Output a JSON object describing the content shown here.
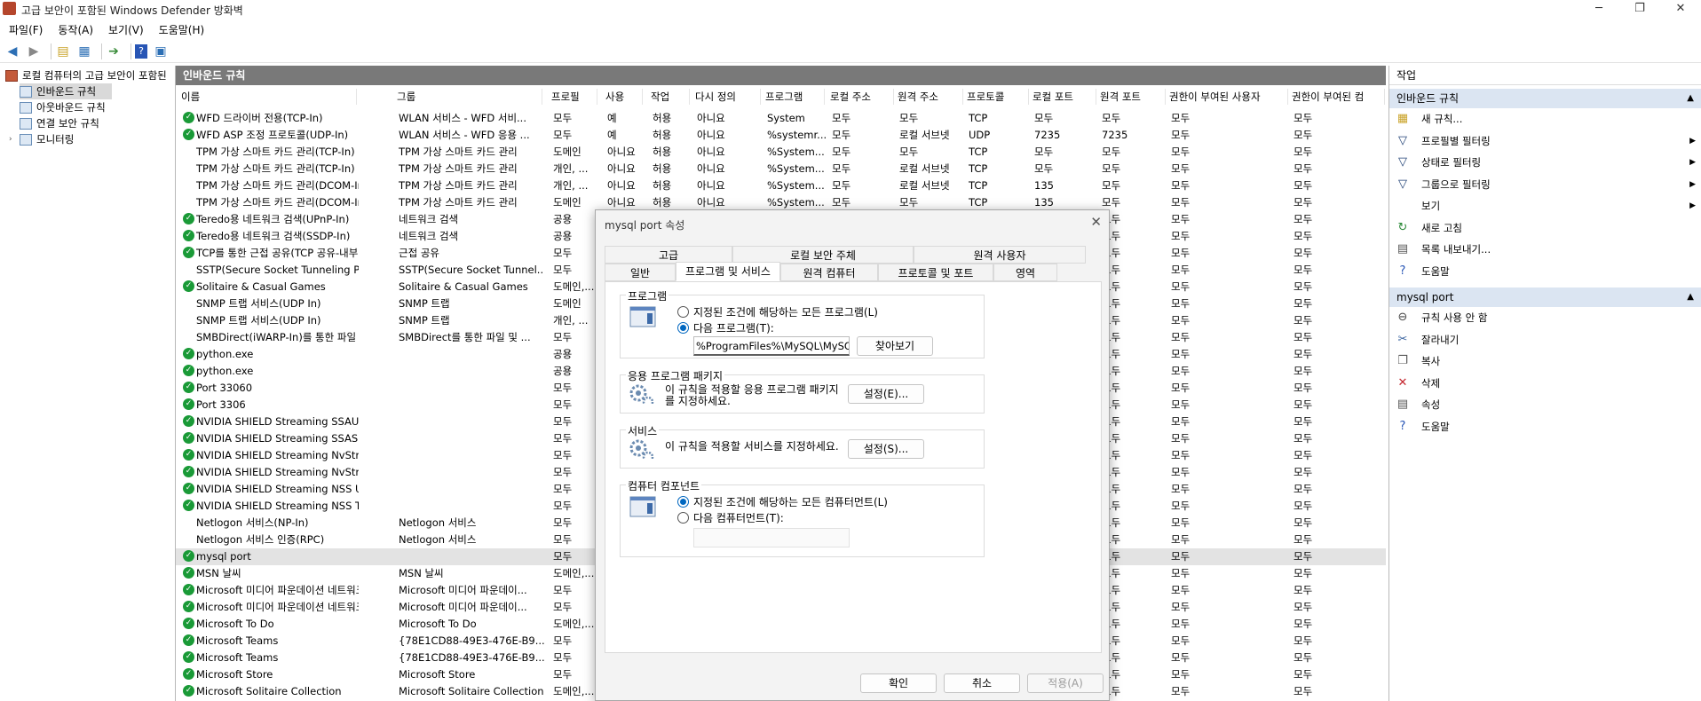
{
  "window": {
    "title": "고급 보안이 포함된 Windows Defender 방화벽",
    "controls": [
      "─",
      "❐",
      "✕"
    ]
  },
  "menu": [
    "파일(F)",
    "동작(A)",
    "보기(V)",
    "도움말(H)"
  ],
  "toolbar": {
    "icons": [
      "back-arrow-icon",
      "forward-arrow-icon",
      "folder-up-icon",
      "console-tree-icon",
      "export-icon",
      "help-icon",
      "properties-icon"
    ]
  },
  "tree": {
    "root": "로컬 컴퓨터의 고급 보안이 포함된 Windows Defender 방화벽",
    "items": [
      "인바운드 규칙",
      "아웃바운드 규칙",
      "연결 보안 규칙",
      "모니터링"
    ]
  },
  "center": {
    "title": "인바운드 규칙",
    "columns": [
      "이름",
      "그룹",
      "프로필",
      "사용",
      "작업",
      "다시 정의",
      "프로그램",
      "로컬 주소",
      "원격 주소",
      "프로토콜",
      "로컬 포트",
      "원격 포트",
      "권한이 부여된 사용자",
      "권한이 부여된 컴"
    ],
    "rows": [
      {
        "e": true,
        "c": [
          "WFD 드라이버 전용(TCP-In)",
          "WLAN 서비스 - WFD 서비...",
          "모두",
          "예",
          "허용",
          "아니요",
          "System",
          "모두",
          "모두",
          "TCP",
          "모두",
          "모두",
          "모두",
          "모두"
        ]
      },
      {
        "e": true,
        "c": [
          "WFD ASP 조정 프로토콜(UDP-In)",
          "WLAN 서비스 - WFD 응용 ...",
          "모두",
          "예",
          "허용",
          "아니요",
          "%systemr...",
          "모두",
          "로컬 서브넷",
          "UDP",
          "7235",
          "7235",
          "모두",
          "모두"
        ]
      },
      {
        "e": false,
        "c": [
          "TPM 가상 스마트 카드 관리(TCP-In)",
          "TPM 가상 스마트 카드 관리",
          "도메인",
          "아니요",
          "허용",
          "아니요",
          "%System...",
          "모두",
          "모두",
          "TCP",
          "모두",
          "모두",
          "모두",
          "모두"
        ]
      },
      {
        "e": false,
        "c": [
          "TPM 가상 스마트 카드 관리(TCP-In)",
          "TPM 가상 스마트 카드 관리",
          "개인, ...",
          "아니요",
          "허용",
          "아니요",
          "%System...",
          "모두",
          "로컬 서브넷",
          "TCP",
          "모두",
          "모두",
          "모두",
          "모두"
        ]
      },
      {
        "e": false,
        "c": [
          "TPM 가상 스마트 카드 관리(DCOM-In)",
          "TPM 가상 스마트 카드 관리",
          "개인, ...",
          "아니요",
          "허용",
          "아니요",
          "%System...",
          "모두",
          "로컬 서브넷",
          "TCP",
          "135",
          "모두",
          "모두",
          "모두"
        ]
      },
      {
        "e": false,
        "c": [
          "TPM 가상 스마트 카드 관리(DCOM-In)",
          "TPM 가상 스마트 카드 관리",
          "도메인",
          "아니요",
          "허용",
          "아니요",
          "%System...",
          "모두",
          "모두",
          "TCP",
          "135",
          "모두",
          "모두",
          "모두"
        ]
      },
      {
        "e": true,
        "c": [
          "Teredo용 네트워크 검색(UPnP-In)",
          "네트워크 검색",
          "공용",
          "",
          "",
          "",
          "",
          "",
          "",
          "",
          "",
          "모두",
          "모두",
          "모두"
        ]
      },
      {
        "e": true,
        "c": [
          "Teredo용 네트워크 검색(SSDP-In)",
          "네트워크 검색",
          "공용",
          "",
          "",
          "",
          "",
          "",
          "",
          "",
          "",
          "모두",
          "모두",
          "모두"
        ]
      },
      {
        "e": true,
        "c": [
          "TCP를 통한 근접 공유(TCP 공유-내부)",
          "근접 공유",
          "모두",
          "",
          "",
          "",
          "",
          "",
          "",
          "",
          "",
          "모두",
          "모두",
          "모두"
        ]
      },
      {
        "e": false,
        "c": [
          "SSTP(Secure Socket Tunneling Protocol)...",
          "SSTP(Secure Socket Tunnel...",
          "모두",
          "",
          "",
          "",
          "",
          "",
          "",
          "",
          "",
          "모두",
          "모두",
          "모두"
        ]
      },
      {
        "e": true,
        "c": [
          "Solitaire & Casual Games",
          "Solitaire & Casual Games",
          "도메인,...",
          "",
          "",
          "",
          "",
          "",
          "",
          "",
          "",
          "모두",
          "모두",
          "모두"
        ]
      },
      {
        "e": false,
        "c": [
          "SNMP 트랩 서비스(UDP In)",
          "SNMP 트랩",
          "도메인",
          "",
          "",
          "",
          "",
          "",
          "",
          "",
          "",
          "모두",
          "모두",
          "모두"
        ]
      },
      {
        "e": false,
        "c": [
          "SNMP 트랩 서비스(UDP In)",
          "SNMP 트랩",
          "개인, ...",
          "",
          "",
          "",
          "",
          "",
          "",
          "",
          "",
          "모두",
          "모두",
          "모두"
        ]
      },
      {
        "e": false,
        "c": [
          "SMBDirect(iWARP-In)를 통한 파일 및 프...",
          "SMBDirect를 통한 파일 및 ...",
          "모두",
          "",
          "",
          "",
          "",
          "",
          "",
          "",
          "",
          "모두",
          "모두",
          "모두"
        ]
      },
      {
        "e": true,
        "c": [
          "python.exe",
          "",
          "공용",
          "",
          "",
          "",
          "",
          "",
          "",
          "",
          "",
          "모두",
          "모두",
          "모두"
        ]
      },
      {
        "e": true,
        "c": [
          "python.exe",
          "",
          "공용",
          "",
          "",
          "",
          "",
          "",
          "",
          "",
          "",
          "모두",
          "모두",
          "모두"
        ]
      },
      {
        "e": true,
        "c": [
          "Port 33060",
          "",
          "모두",
          "",
          "",
          "",
          "",
          "",
          "",
          "",
          "",
          "모두",
          "모두",
          "모두"
        ]
      },
      {
        "e": true,
        "c": [
          "Port 3306",
          "",
          "모두",
          "",
          "",
          "",
          "",
          "",
          "",
          "",
          "",
          "모두",
          "모두",
          "모두"
        ]
      },
      {
        "e": true,
        "c": [
          "NVIDIA SHIELD Streaming SSAU UDP E...",
          "",
          "모두",
          "",
          "",
          "",
          "",
          "",
          "",
          "",
          "",
          "모두",
          "모두",
          "모두"
        ]
      },
      {
        "e": true,
        "c": [
          "NVIDIA SHIELD Streaming SSAS UDP E...",
          "",
          "모두",
          "",
          "",
          "",
          "",
          "",
          "",
          "",
          "",
          "모두",
          "모두",
          "모두"
        ]
      },
      {
        "e": true,
        "c": [
          "NVIDIA SHIELD Streaming NvStreamer ...",
          "",
          "모두",
          "",
          "",
          "",
          "",
          "",
          "",
          "",
          "",
          "모두",
          "모두",
          "모두"
        ]
      },
      {
        "e": true,
        "c": [
          "NVIDIA SHIELD Streaming NvStreamer ...",
          "",
          "모두",
          "",
          "",
          "",
          "",
          "",
          "",
          "",
          "",
          "모두",
          "모두",
          "모두"
        ]
      },
      {
        "e": true,
        "c": [
          "NVIDIA SHIELD Streaming NSS UDP Ex...",
          "",
          "모두",
          "",
          "",
          "",
          "",
          "",
          "",
          "",
          "",
          "모두",
          "모두",
          "모두"
        ]
      },
      {
        "e": true,
        "c": [
          "NVIDIA SHIELD Streaming NSS TCP Exc...",
          "",
          "모두",
          "",
          "",
          "",
          "",
          "",
          "",
          "",
          "",
          "모두",
          "모두",
          "모두"
        ]
      },
      {
        "e": false,
        "c": [
          "Netlogon 서비스(NP-In)",
          "Netlogon 서비스",
          "모두",
          "",
          "",
          "",
          "",
          "",
          "",
          "",
          "",
          "모두",
          "모두",
          "모두"
        ]
      },
      {
        "e": false,
        "c": [
          "Netlogon 서비스 인증(RPC)",
          "Netlogon 서비스",
          "모두",
          "",
          "",
          "",
          "",
          "",
          "",
          "",
          "",
          "모두",
          "모두",
          "모두"
        ]
      },
      {
        "e": true,
        "s": true,
        "c": [
          "mysql port",
          "",
          "모두",
          "",
          "",
          "",
          "",
          "",
          "",
          "",
          "",
          "모두",
          "모두",
          "모두"
        ]
      },
      {
        "e": true,
        "c": [
          "MSN 날씨",
          "MSN 날씨",
          "도메인,...",
          "",
          "",
          "",
          "",
          "",
          "",
          "",
          "",
          "모두",
          "모두",
          "모두"
        ]
      },
      {
        "e": true,
        "c": [
          "Microsoft 미디어 파운데이션 네트워크 ...",
          "Microsoft 미디어 파운데이...",
          "모두",
          "",
          "",
          "",
          "",
          "",
          "",
          "",
          "",
          "모두",
          "모두",
          "모두"
        ]
      },
      {
        "e": true,
        "c": [
          "Microsoft 미디어 파운데이션 네트워크 ...",
          "Microsoft 미디어 파운데이...",
          "모두",
          "",
          "",
          "",
          "",
          "",
          "",
          "",
          "",
          "모두",
          "모두",
          "모두"
        ]
      },
      {
        "e": true,
        "c": [
          "Microsoft To Do",
          "Microsoft To Do",
          "도메인,...",
          "",
          "",
          "",
          "",
          "",
          "",
          "",
          "",
          "모두",
          "모두",
          "모두"
        ]
      },
      {
        "e": true,
        "c": [
          "Microsoft Teams",
          "{78E1CD88-49E3-476E-B9...",
          "모두",
          "",
          "",
          "",
          "",
          "",
          "",
          "",
          "",
          "모두",
          "모두",
          "모두"
        ]
      },
      {
        "e": true,
        "c": [
          "Microsoft Teams",
          "{78E1CD88-49E3-476E-B9...",
          "모두",
          "",
          "",
          "",
          "",
          "",
          "",
          "",
          "",
          "모두",
          "모두",
          "모두"
        ]
      },
      {
        "e": true,
        "c": [
          "Microsoft Store",
          "Microsoft Store",
          "모두",
          "",
          "",
          "",
          "",
          "",
          "",
          "",
          "",
          "모두",
          "모두",
          "모두"
        ]
      },
      {
        "e": true,
        "c": [
          "Microsoft Solitaire Collection",
          "Microsoft Solitaire Collection",
          "도메인,...",
          "",
          "",
          "",
          "",
          "",
          "",
          "",
          "",
          "모두",
          "모두",
          "모두"
        ]
      }
    ]
  },
  "actions": {
    "header": "작업",
    "sec1": "인바운드 규칙",
    "items1": [
      {
        "label": "새 규칙...",
        "icon": "new-rule-icon",
        "sub": false
      },
      {
        "label": "프로필별 필터링",
        "icon": "filter-icon",
        "sub": true
      },
      {
        "label": "상태로 필터링",
        "icon": "filter-icon",
        "sub": true
      },
      {
        "label": "그룹으로 필터링",
        "icon": "filter-icon",
        "sub": true
      },
      {
        "label": "보기",
        "icon": "",
        "sub": true
      },
      {
        "label": "새로 고침",
        "icon": "refresh-icon",
        "sub": false
      },
      {
        "label": "목록 내보내기...",
        "icon": "export-list-icon",
        "sub": false
      },
      {
        "label": "도움말",
        "icon": "help-icon",
        "sub": false
      }
    ],
    "sec2": "mysql port",
    "items2": [
      {
        "label": "규칙 사용 안 함",
        "icon": "disable-rule-icon"
      },
      {
        "label": "잘라내기",
        "icon": "cut-icon"
      },
      {
        "label": "복사",
        "icon": "copy-icon"
      },
      {
        "label": "삭제",
        "icon": "delete-icon"
      },
      {
        "label": "속성",
        "icon": "properties-icon"
      },
      {
        "label": "도움말",
        "icon": "help-icon"
      }
    ]
  },
  "dialog": {
    "title": "mysql port 속성",
    "tabs_row1": [
      "고급",
      "로컬 보안 주체",
      "원격 사용자"
    ],
    "tabs_row2": [
      "일반",
      "프로그램 및 서비스",
      "원격 컴퓨터",
      "프로토콜 및 포트",
      "영역"
    ],
    "programs": {
      "label": "프로그램",
      "opt_all": "지정된 조건에 해당하는 모든 프로그램(L)",
      "opt_this": "다음 프로그램(T):",
      "path": "%ProgramFiles%\\MySQL\\MySQL S",
      "browse": "찾아보기"
    },
    "packages": {
      "label": "응용 프로그램 패키지",
      "desc": "이 규칙을 적용할 응용 프로그램 패키지를 지정하세요.",
      "btn": "설정(E)..."
    },
    "services": {
      "label": "서비스",
      "desc": "이 규칙을 적용할 서비스를 지정하세요.",
      "btn": "설정(S)..."
    },
    "components": {
      "label": "컴퓨터 컴포넌트",
      "opt_all": "지정된 조건에 해당하는 모든 컴퓨터먼트(L)",
      "opt_this": "다음 컴퓨터먼트(T):"
    },
    "ok": "확인",
    "cancel": "취소",
    "apply": "적용(A)"
  }
}
